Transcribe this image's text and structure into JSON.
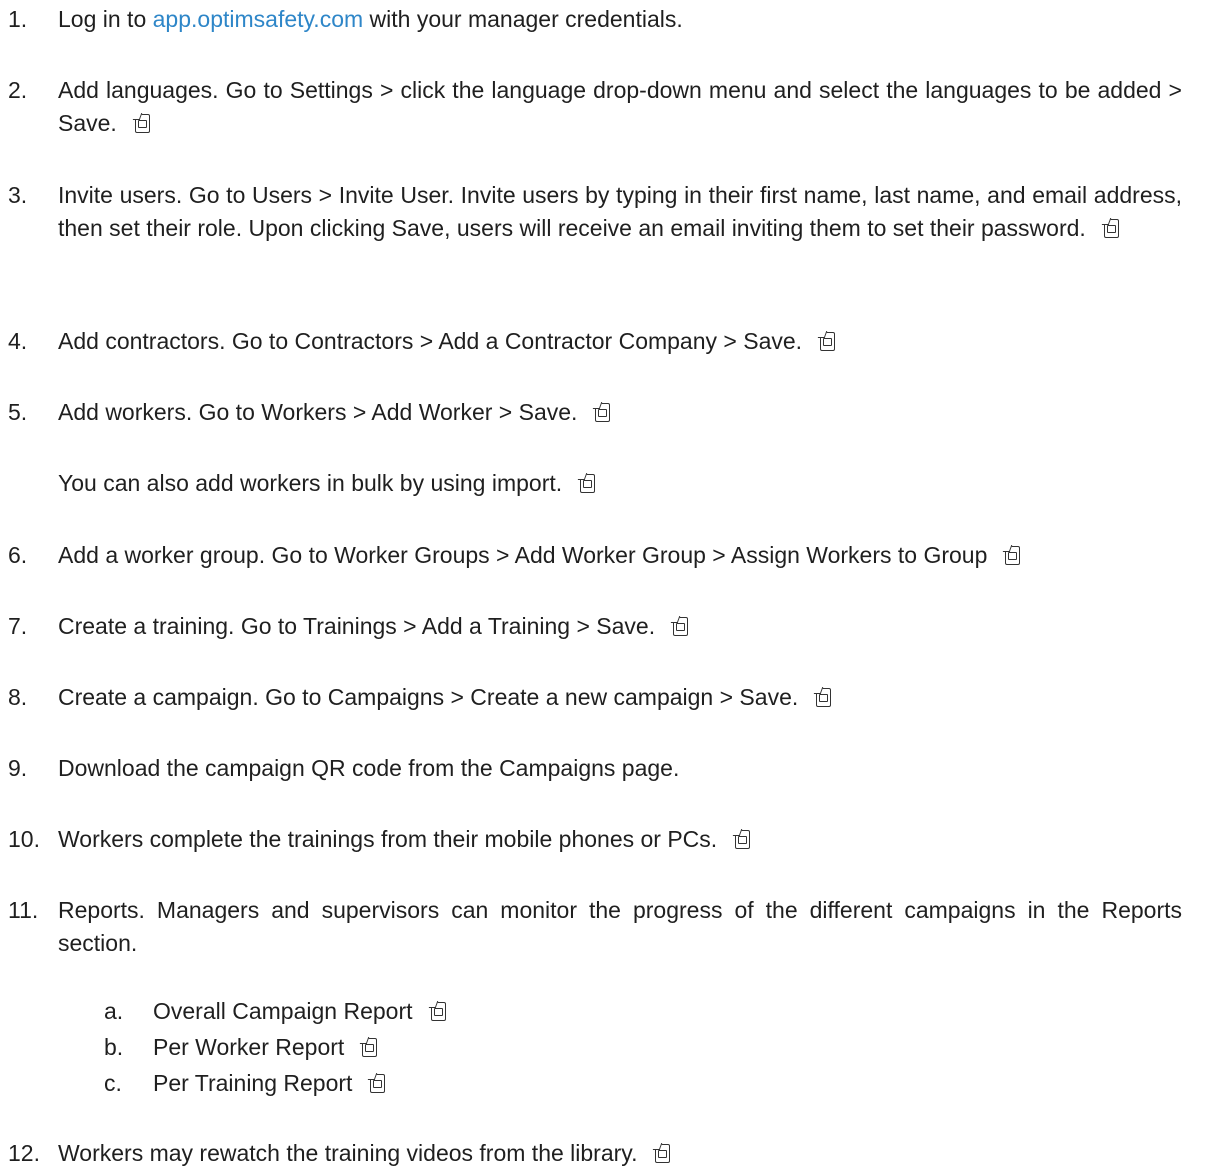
{
  "steps": [
    {
      "n": "1.",
      "prefix": "Log in to ",
      "link": "app.optimsafety.com",
      "suffix": " with your manager credentials."
    },
    {
      "n": "2.",
      "text": "Add languages. Go to Settings > click the language drop-down menu and select the languages to be added > Save."
    },
    {
      "n": "3.",
      "text": "Invite users. Go to Users > Invite User. Invite users by typing in their first name, last name, and email address, then set their role. Upon clicking Save, users will receive an email inviting them to set their password."
    },
    {
      "n": "4.",
      "text": "Add contractors. Go to Contractors > Add a Contractor Company > Save."
    },
    {
      "n": "5.",
      "text": "Add workers. Go to Workers > Add Worker > Save.",
      "note": "You can also add workers in bulk by using import."
    },
    {
      "n": "6.",
      "text": "Add a worker group. Go to Worker Groups > Add Worker Group > Assign Workers to Group"
    },
    {
      "n": "7.",
      "text": "Create a training. Go to Trainings > Add a Training > Save."
    },
    {
      "n": "8.",
      "text": "Create a campaign. Go to Campaigns > Create a new campaign > Save."
    },
    {
      "n": "9.",
      "text": "Download the campaign QR code from the Campaigns page."
    },
    {
      "n": "10.",
      "text": "Workers complete the trainings from their mobile phones or PCs."
    },
    {
      "n": "11.",
      "text": "Reports. Managers and supervisors can monitor the progress of the different campaigns in the Reports section.",
      "subs": [
        {
          "n": "a.",
          "text": "Overall Campaign Report"
        },
        {
          "n": "b.",
          "text": "Per Worker Report"
        },
        {
          "n": "c.",
          "text": "Per Training Report"
        }
      ]
    },
    {
      "n": "12.",
      "text": "Workers may rewatch the training videos from the library."
    }
  ],
  "icons": {
    "attachment": "document-attachment-icon"
  }
}
